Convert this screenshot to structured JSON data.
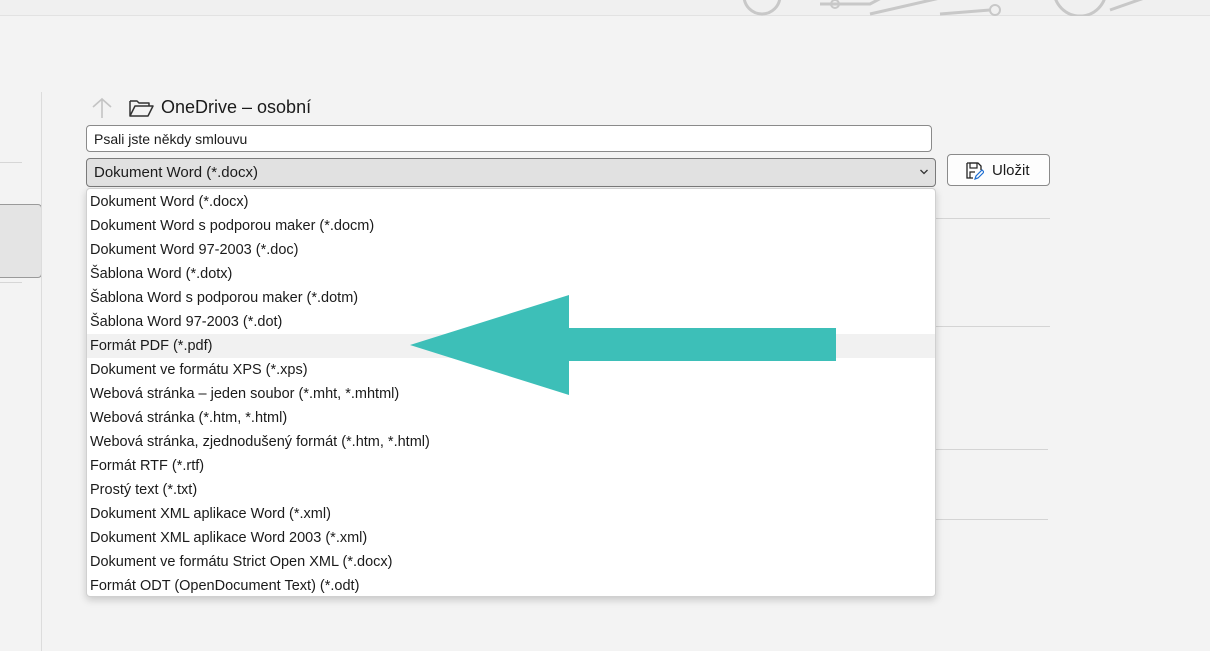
{
  "location": {
    "title": "OneDrive – osobní"
  },
  "filename": {
    "value": "Psali jste někdy smlouvu"
  },
  "filetype": {
    "selected": "Dokument Word (*.docx)",
    "options": [
      "Dokument Word (*.docx)",
      "Dokument Word s podporou maker (*.docm)",
      "Dokument Word 97-2003 (*.doc)",
      "Šablona Word (*.dotx)",
      "Šablona Word s podporou maker (*.dotm)",
      "Šablona Word 97-2003 (*.dot)",
      "Formát PDF (*.pdf)",
      "Dokument ve formátu XPS (*.xps)",
      "Webová stránka – jeden soubor (*.mht, *.mhtml)",
      "Webová stránka (*.htm, *.html)",
      "Webová stránka, zjednodušený formát (*.htm, *.html)",
      "Formát RTF (*.rtf)",
      "Prostý text (*.txt)",
      "Dokument XML aplikace Word (*.xml)",
      "Dokument XML aplikace Word 2003 (*.xml)",
      "Dokument ve formátu Strict Open XML (*.docx)",
      "Formát ODT (OpenDocument Text) (*.odt)"
    ],
    "highlighted": "Formát PDF (*.pdf)"
  },
  "save_button": {
    "label": "Uložit"
  },
  "icons": {
    "up": "arrow-up-icon",
    "folder": "folder-open-icon",
    "save": "save-edit-icon",
    "dropdown": "chevron-down-icon"
  },
  "colors": {
    "pointer_arrow": "#3dbfb8",
    "dropdown_bg": "#ffffff",
    "field_bg": "#e1e1e1"
  }
}
